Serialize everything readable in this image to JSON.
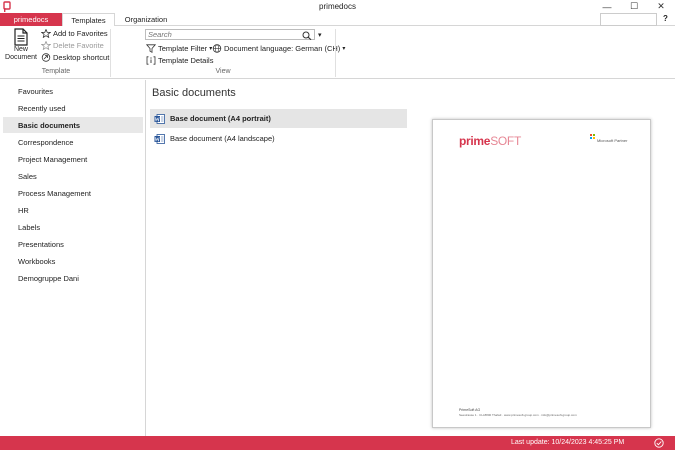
{
  "window": {
    "title": "primedocs",
    "minimize": "—",
    "maximize": "☐",
    "close": "✕",
    "help": "?"
  },
  "tabs": {
    "brand": "primedocs",
    "templates": "Templates",
    "organization": "Organization"
  },
  "ribbon": {
    "new_document": {
      "line1": "New",
      "line2": "Document"
    },
    "add_favorites": "Add to Favorites",
    "delete_favorite": "Delete Favorite",
    "desktop_shortcut": "Desktop shortcut",
    "group_template": "Template",
    "search_placeholder": "Search",
    "template_filter": "Template Filter",
    "document_language": "Document language: German (CH)",
    "template_details": "Template Details",
    "group_view": "View",
    "dropdown_arrow": "▾"
  },
  "sidebar": {
    "items": [
      {
        "label": "Favourites"
      },
      {
        "label": "Recently used"
      },
      {
        "label": "Basic documents",
        "active": true
      },
      {
        "label": "Correspondence"
      },
      {
        "label": "Project Management"
      },
      {
        "label": "Sales"
      },
      {
        "label": "Process Management"
      },
      {
        "label": "HR"
      },
      {
        "label": "Labels"
      },
      {
        "label": "Presentations"
      },
      {
        "label": "Workbooks"
      },
      {
        "label": "Demogruppe Dani"
      }
    ]
  },
  "main": {
    "section_title": "Basic documents",
    "documents": [
      {
        "label": "Base document (A4 portrait)",
        "selected": true
      },
      {
        "label": "Base document (A4 landscape)",
        "selected": false
      }
    ]
  },
  "preview": {
    "brand_part1": "prime",
    "brand_part2": "SOFT",
    "partner": "Microsoft Partner",
    "footer_line1": "PrimeSoft AG",
    "footer_line2": "Seestrasse 1 · CH-8800 Thalwil · www.primesoft-group.com · info@primesoft-group.com"
  },
  "status": {
    "last_update": "Last update: 10/24/2023 4:45:25 PM"
  },
  "colors": {
    "accent": "#d6354d",
    "selection": "#e5e5e5"
  },
  "icons": {
    "app": "app-logo-icon",
    "new_document": "new-document-icon",
    "add_favorites": "star-add-icon",
    "delete_favorite": "star-delete-icon",
    "desktop_shortcut": "shortcut-icon",
    "search": "search-icon",
    "filter": "filter-icon",
    "language": "globe-icon",
    "details": "details-icon",
    "word_document": "word-document-icon",
    "status": "check-circle-icon"
  }
}
